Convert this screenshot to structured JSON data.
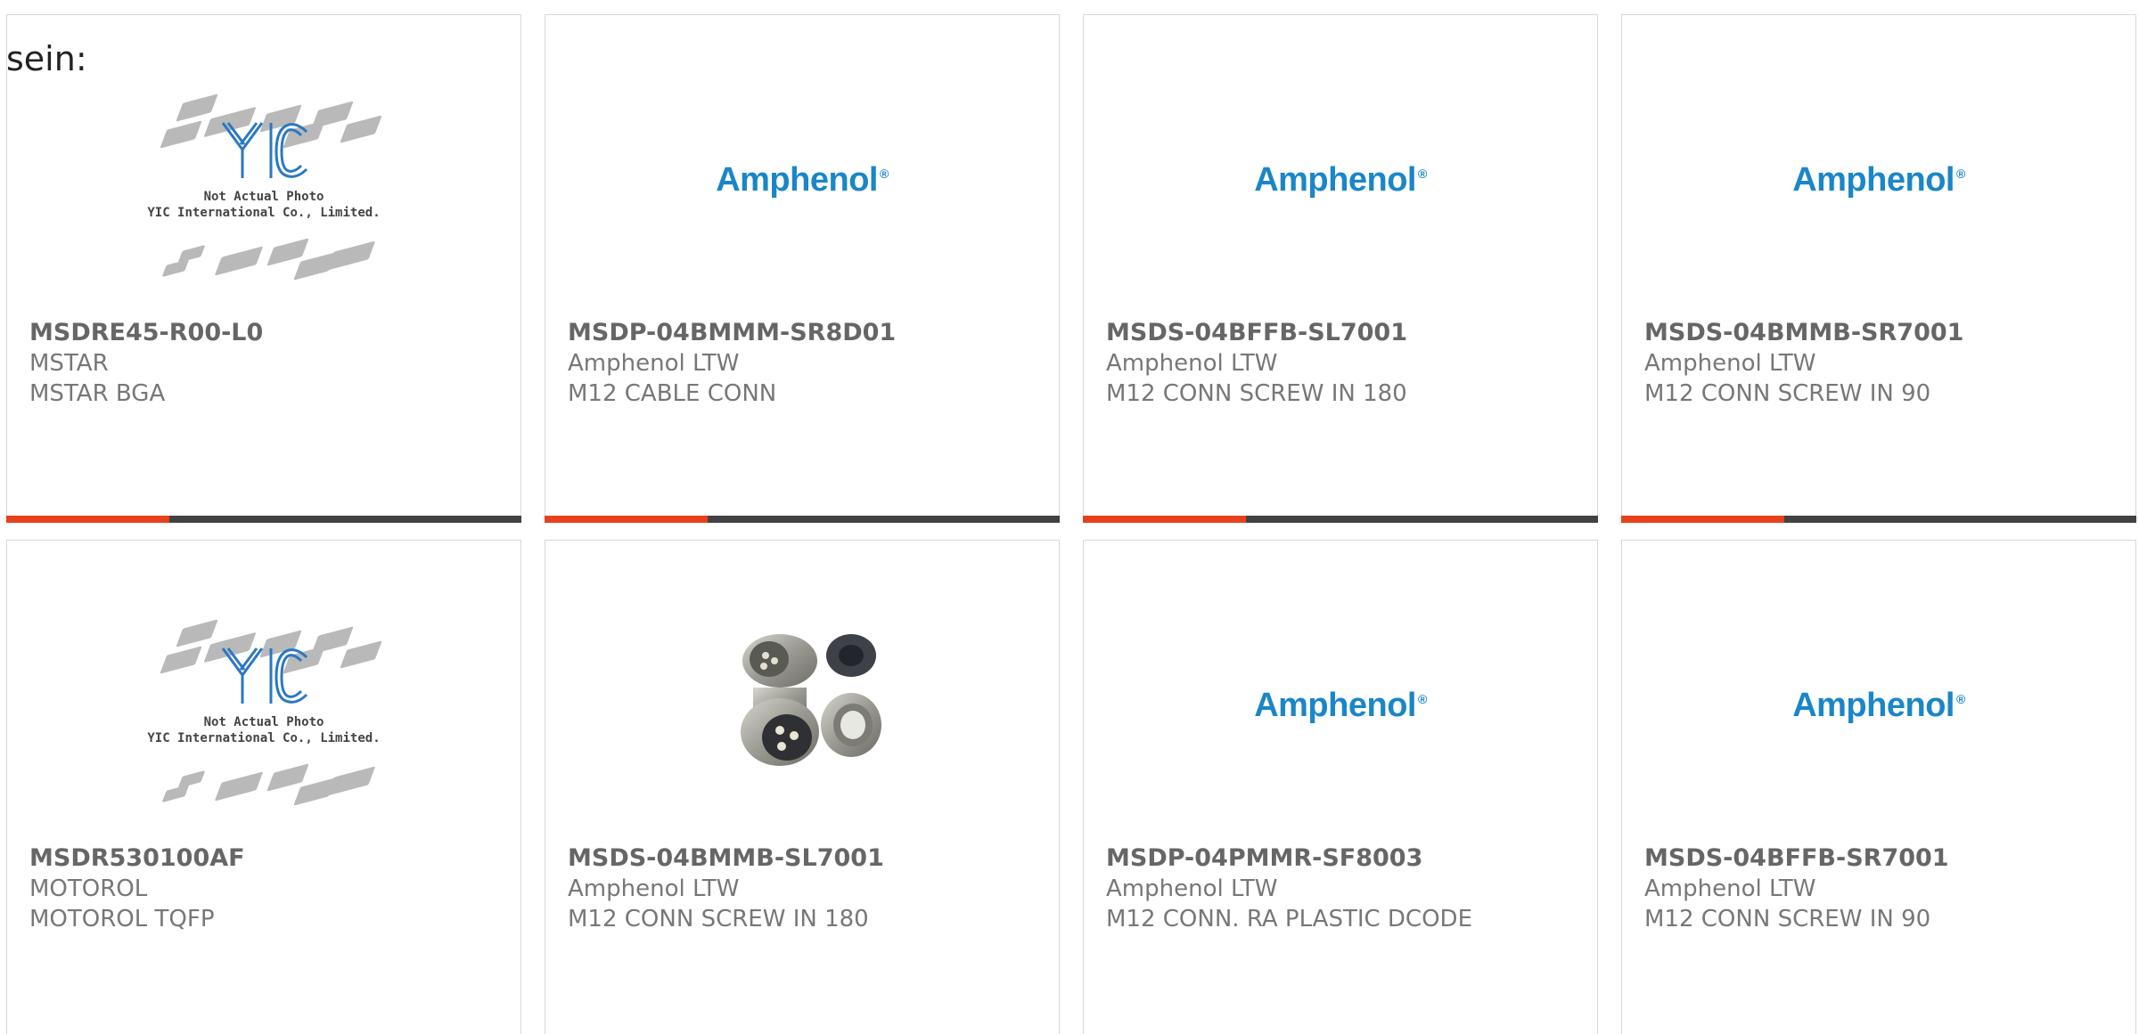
{
  "intro_text": "sein:",
  "products": [
    {
      "part_number": "MSDRE45-R00-L0",
      "manufacturer": "MSTAR",
      "description": "MSTAR BGA",
      "image": "yic-placeholder"
    },
    {
      "part_number": "MSDP-04BMMM-SR8D01",
      "manufacturer": "Amphenol LTW",
      "description": "M12 CABLE CONN",
      "image": "amphenol-logo"
    },
    {
      "part_number": "MSDS-04BFFB-SL7001",
      "manufacturer": "Amphenol LTW",
      "description": "M12 CONN SCREW IN 180",
      "image": "amphenol-logo"
    },
    {
      "part_number": "MSDS-04BMMB-SR7001",
      "manufacturer": "Amphenol LTW",
      "description": "M12 CONN SCREW IN 90",
      "image": "amphenol-logo"
    },
    {
      "part_number": "MSDR530100AF",
      "manufacturer": "MOTOROL",
      "description": "MOTOROL TQFP",
      "image": "yic-placeholder"
    },
    {
      "part_number": "MSDS-04BMMB-SL7001",
      "manufacturer": "Amphenol LTW",
      "description": "M12 CONN SCREW IN 180",
      "image": "connector-photo"
    },
    {
      "part_number": "MSDP-04PMMR-SF8003",
      "manufacturer": "Amphenol LTW",
      "description": "M12 CONN. RA PLASTIC DCODE",
      "image": "amphenol-logo"
    },
    {
      "part_number": "MSDS-04BFFB-SR7001",
      "manufacturer": "Amphenol LTW",
      "description": "M12 CONN SCREW IN 90",
      "image": "amphenol-logo"
    }
  ],
  "amphenol_logo_text": "Amphenol",
  "amphenol_logo_mark": "®",
  "yic_placeholder": {
    "line1": "Not Actual Photo",
    "line2": "YIC International Co., Limited."
  },
  "colors": {
    "accent": "#e8401c",
    "bar": "#424242",
    "logo_blue": "#1a86c8"
  }
}
